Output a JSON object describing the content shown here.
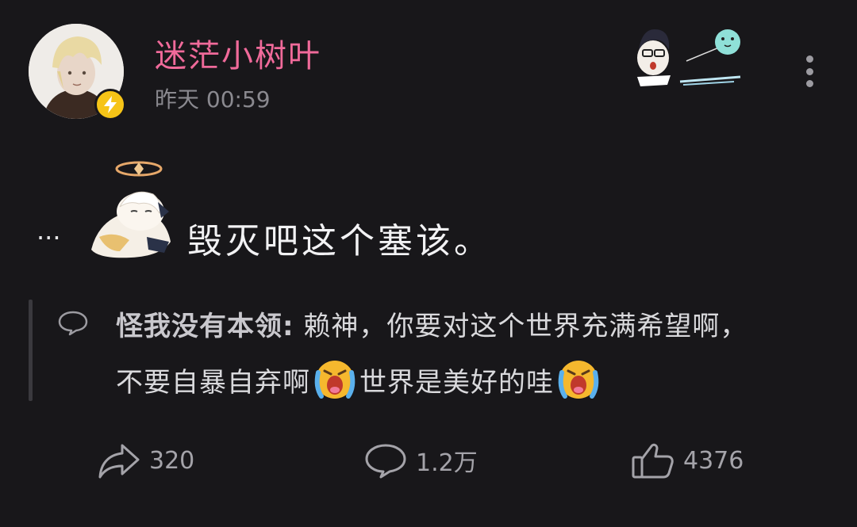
{
  "post": {
    "author": {
      "name": "迷茫小树叶",
      "avatar_icon": "avatar",
      "badge_icon": "lightning-badge-icon"
    },
    "timestamp": "昨天 00:59",
    "more_icon": "more-vertical-icon",
    "prefix": "...",
    "text": "毁灭吧这个塞该。",
    "sticker_icon": "paimon-sticker"
  },
  "comment_preview": {
    "author": "怪我没有本领:",
    "line1_text": "赖神，你要对这个世界充满希望啊，",
    "line2_part1": "不要自暴自弃啊",
    "line2_part2": "世界是美好的哇",
    "emoji_icon": "crying-emoji-icon"
  },
  "actions": {
    "share_count": "320",
    "comment_count": "1.2万",
    "like_count": "4376"
  },
  "colors": {
    "background": "#18171a",
    "username": "#f06a9a",
    "badge": "#f6c417"
  }
}
